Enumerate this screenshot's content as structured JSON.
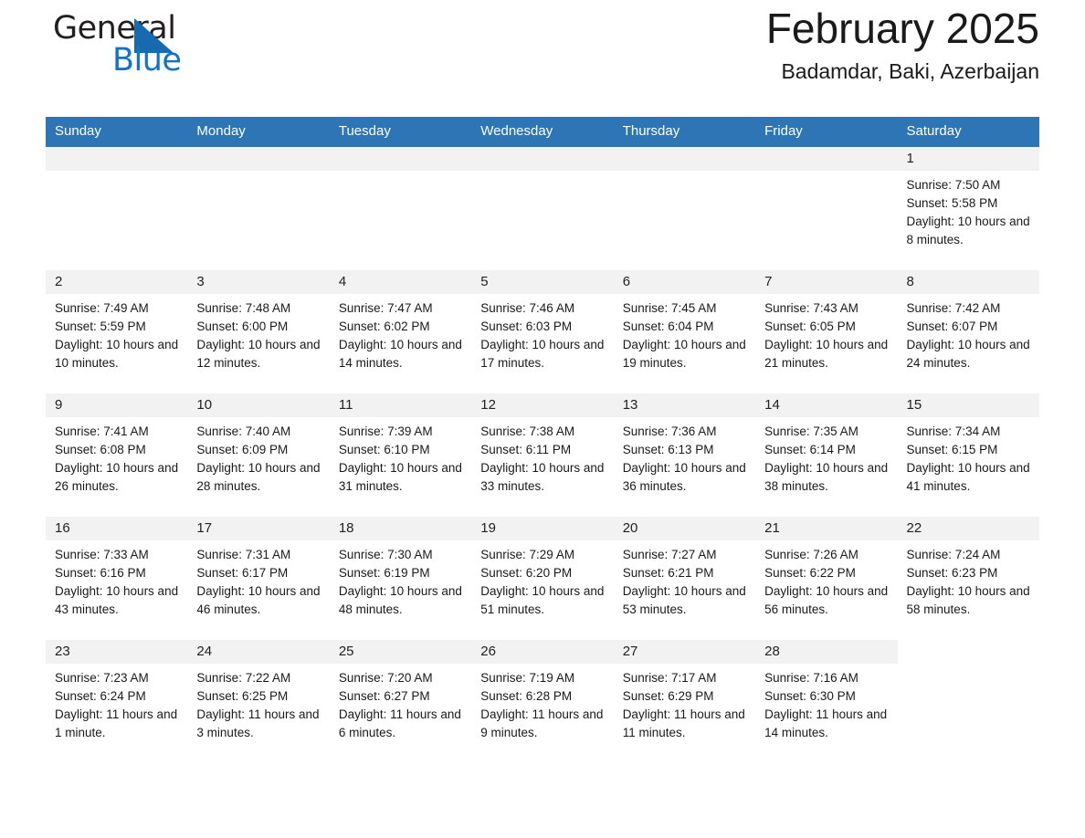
{
  "brand": {
    "name_part1": "General",
    "name_part2": "Blue",
    "accent_color": "#1273cd",
    "triangle_color": "#1769b0"
  },
  "header": {
    "title": "February 2025",
    "subtitle": "Badamdar, Baki, Azerbaijan"
  },
  "calendar": {
    "header_bg": "#2e75b6",
    "daynum_bg": "#f2f2f2",
    "weekdays": [
      "Sunday",
      "Monday",
      "Tuesday",
      "Wednesday",
      "Thursday",
      "Friday",
      "Saturday"
    ],
    "weeks": [
      [
        {
          "empty": true
        },
        {
          "empty": true
        },
        {
          "empty": true
        },
        {
          "empty": true
        },
        {
          "empty": true
        },
        {
          "empty": true
        },
        {
          "day": "1",
          "sunrise": "Sunrise: 7:50 AM",
          "sunset": "Sunset: 5:58 PM",
          "daylight": "Daylight: 10 hours and 8 minutes."
        }
      ],
      [
        {
          "day": "2",
          "sunrise": "Sunrise: 7:49 AM",
          "sunset": "Sunset: 5:59 PM",
          "daylight": "Daylight: 10 hours and 10 minutes."
        },
        {
          "day": "3",
          "sunrise": "Sunrise: 7:48 AM",
          "sunset": "Sunset: 6:00 PM",
          "daylight": "Daylight: 10 hours and 12 minutes."
        },
        {
          "day": "4",
          "sunrise": "Sunrise: 7:47 AM",
          "sunset": "Sunset: 6:02 PM",
          "daylight": "Daylight: 10 hours and 14 minutes."
        },
        {
          "day": "5",
          "sunrise": "Sunrise: 7:46 AM",
          "sunset": "Sunset: 6:03 PM",
          "daylight": "Daylight: 10 hours and 17 minutes."
        },
        {
          "day": "6",
          "sunrise": "Sunrise: 7:45 AM",
          "sunset": "Sunset: 6:04 PM",
          "daylight": "Daylight: 10 hours and 19 minutes."
        },
        {
          "day": "7",
          "sunrise": "Sunrise: 7:43 AM",
          "sunset": "Sunset: 6:05 PM",
          "daylight": "Daylight: 10 hours and 21 minutes."
        },
        {
          "day": "8",
          "sunrise": "Sunrise: 7:42 AM",
          "sunset": "Sunset: 6:07 PM",
          "daylight": "Daylight: 10 hours and 24 minutes."
        }
      ],
      [
        {
          "day": "9",
          "sunrise": "Sunrise: 7:41 AM",
          "sunset": "Sunset: 6:08 PM",
          "daylight": "Daylight: 10 hours and 26 minutes."
        },
        {
          "day": "10",
          "sunrise": "Sunrise: 7:40 AM",
          "sunset": "Sunset: 6:09 PM",
          "daylight": "Daylight: 10 hours and 28 minutes."
        },
        {
          "day": "11",
          "sunrise": "Sunrise: 7:39 AM",
          "sunset": "Sunset: 6:10 PM",
          "daylight": "Daylight: 10 hours and 31 minutes."
        },
        {
          "day": "12",
          "sunrise": "Sunrise: 7:38 AM",
          "sunset": "Sunset: 6:11 PM",
          "daylight": "Daylight: 10 hours and 33 minutes."
        },
        {
          "day": "13",
          "sunrise": "Sunrise: 7:36 AM",
          "sunset": "Sunset: 6:13 PM",
          "daylight": "Daylight: 10 hours and 36 minutes."
        },
        {
          "day": "14",
          "sunrise": "Sunrise: 7:35 AM",
          "sunset": "Sunset: 6:14 PM",
          "daylight": "Daylight: 10 hours and 38 minutes."
        },
        {
          "day": "15",
          "sunrise": "Sunrise: 7:34 AM",
          "sunset": "Sunset: 6:15 PM",
          "daylight": "Daylight: 10 hours and 41 minutes."
        }
      ],
      [
        {
          "day": "16",
          "sunrise": "Sunrise: 7:33 AM",
          "sunset": "Sunset: 6:16 PM",
          "daylight": "Daylight: 10 hours and 43 minutes."
        },
        {
          "day": "17",
          "sunrise": "Sunrise: 7:31 AM",
          "sunset": "Sunset: 6:17 PM",
          "daylight": "Daylight: 10 hours and 46 minutes."
        },
        {
          "day": "18",
          "sunrise": "Sunrise: 7:30 AM",
          "sunset": "Sunset: 6:19 PM",
          "daylight": "Daylight: 10 hours and 48 minutes."
        },
        {
          "day": "19",
          "sunrise": "Sunrise: 7:29 AM",
          "sunset": "Sunset: 6:20 PM",
          "daylight": "Daylight: 10 hours and 51 minutes."
        },
        {
          "day": "20",
          "sunrise": "Sunrise: 7:27 AM",
          "sunset": "Sunset: 6:21 PM",
          "daylight": "Daylight: 10 hours and 53 minutes."
        },
        {
          "day": "21",
          "sunrise": "Sunrise: 7:26 AM",
          "sunset": "Sunset: 6:22 PM",
          "daylight": "Daylight: 10 hours and 56 minutes."
        },
        {
          "day": "22",
          "sunrise": "Sunrise: 7:24 AM",
          "sunset": "Sunset: 6:23 PM",
          "daylight": "Daylight: 10 hours and 58 minutes."
        }
      ],
      [
        {
          "day": "23",
          "sunrise": "Sunrise: 7:23 AM",
          "sunset": "Sunset: 6:24 PM",
          "daylight": "Daylight: 11 hours and 1 minute."
        },
        {
          "day": "24",
          "sunrise": "Sunrise: 7:22 AM",
          "sunset": "Sunset: 6:25 PM",
          "daylight": "Daylight: 11 hours and 3 minutes."
        },
        {
          "day": "25",
          "sunrise": "Sunrise: 7:20 AM",
          "sunset": "Sunset: 6:27 PM",
          "daylight": "Daylight: 11 hours and 6 minutes."
        },
        {
          "day": "26",
          "sunrise": "Sunrise: 7:19 AM",
          "sunset": "Sunset: 6:28 PM",
          "daylight": "Daylight: 11 hours and 9 minutes."
        },
        {
          "day": "27",
          "sunrise": "Sunrise: 7:17 AM",
          "sunset": "Sunset: 6:29 PM",
          "daylight": "Daylight: 11 hours and 11 minutes."
        },
        {
          "day": "28",
          "sunrise": "Sunrise: 7:16 AM",
          "sunset": "Sunset: 6:30 PM",
          "daylight": "Daylight: 11 hours and 14 minutes."
        },
        {
          "empty": true,
          "no_fill": true
        }
      ]
    ]
  }
}
